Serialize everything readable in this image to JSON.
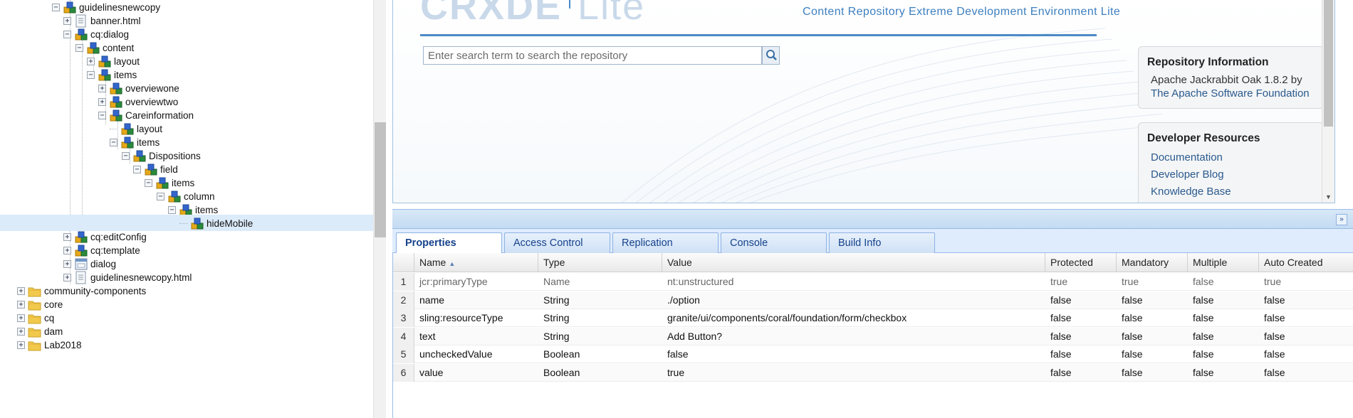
{
  "tree": {
    "nodes": [
      {
        "label": "guidelinesnewcopy",
        "toggle": "minus",
        "icon": "component-node-icon"
      },
      {
        "label": "banner.html",
        "toggle": "plus",
        "icon": "file-icon"
      },
      {
        "label": "cq:dialog",
        "toggle": "minus",
        "icon": "component-node-icon"
      },
      {
        "label": "content",
        "toggle": "minus",
        "icon": "component-node-icon"
      },
      {
        "label": "layout",
        "toggle": "plus",
        "icon": "component-node-icon"
      },
      {
        "label": "items",
        "toggle": "minus",
        "icon": "component-node-icon"
      },
      {
        "label": "overviewone",
        "toggle": "plus",
        "icon": "component-node-icon"
      },
      {
        "label": "overviewtwo",
        "toggle": "plus",
        "icon": "component-node-icon"
      },
      {
        "label": "Careinformation",
        "toggle": "minus",
        "icon": "component-node-icon"
      },
      {
        "label": "layout",
        "toggle": "none",
        "icon": "component-node-icon"
      },
      {
        "label": "items",
        "toggle": "minus",
        "icon": "component-node-icon"
      },
      {
        "label": "Dispositions",
        "toggle": "minus",
        "icon": "component-node-icon"
      },
      {
        "label": "field",
        "toggle": "minus",
        "icon": "component-node-icon"
      },
      {
        "label": "items",
        "toggle": "minus",
        "icon": "component-node-icon"
      },
      {
        "label": "column",
        "toggle": "minus",
        "icon": "component-node-icon"
      },
      {
        "label": "items",
        "toggle": "minus",
        "icon": "component-node-icon"
      },
      {
        "label": "hideMobile",
        "toggle": "none",
        "icon": "component-node-icon",
        "selected": true
      },
      {
        "label": "cq:editConfig",
        "toggle": "plus",
        "icon": "component-node-icon"
      },
      {
        "label": "cq:template",
        "toggle": "plus",
        "icon": "component-node-icon"
      },
      {
        "label": "dialog",
        "toggle": "plus",
        "icon": "dialog-icon"
      },
      {
        "label": "guidelinesnewcopy.html",
        "toggle": "plus",
        "icon": "file-icon"
      },
      {
        "label": "community-components",
        "toggle": "plus",
        "icon": "folder-icon"
      },
      {
        "label": "core",
        "toggle": "plus",
        "icon": "folder-icon"
      },
      {
        "label": "cq",
        "toggle": "plus",
        "icon": "folder-icon"
      },
      {
        "label": "dam",
        "toggle": "plus",
        "icon": "folder-icon"
      },
      {
        "label": "Lab2018",
        "toggle": "plus",
        "icon": "folder-icon"
      }
    ]
  },
  "header": {
    "logo_text_a": "CRXDE",
    "logo_text_b": "Lite",
    "tagline": "Content Repository Extreme Development Environment Lite"
  },
  "search": {
    "placeholder": "Enter search term to search the repository"
  },
  "repository_info": {
    "title": "Repository Information",
    "line1": "Apache Jackrabbit Oak 1.8.2 by",
    "link": "The Apache Software Foundation"
  },
  "developer_resources": {
    "title": "Developer Resources",
    "links": [
      "Documentation",
      "Developer Blog",
      "Knowledge Base"
    ]
  },
  "tabs": [
    {
      "label": "Properties",
      "active": true
    },
    {
      "label": "Access Control",
      "active": false
    },
    {
      "label": "Replication",
      "active": false
    },
    {
      "label": "Console",
      "active": false
    },
    {
      "label": "Build Info",
      "active": false
    }
  ],
  "grid": {
    "columns": [
      "Name",
      "Type",
      "Value",
      "Protected",
      "Mandatory",
      "Multiple",
      "Auto Created"
    ],
    "sorted_column": "Name",
    "sort_direction": "ascending",
    "rows": [
      {
        "num": "1",
        "name": "jcr:primaryType",
        "type": "Name",
        "value": "nt:unstructured",
        "protected": "true",
        "mandatory": "true",
        "multiple": "false",
        "auto": "true",
        "muted": true
      },
      {
        "num": "2",
        "name": "name",
        "type": "String",
        "value": "./option",
        "protected": "false",
        "mandatory": "false",
        "multiple": "false",
        "auto": "false"
      },
      {
        "num": "3",
        "name": "sling:resourceType",
        "type": "String",
        "value": "granite/ui/components/coral/foundation/form/checkbox",
        "protected": "false",
        "mandatory": "false",
        "multiple": "false",
        "auto": "false"
      },
      {
        "num": "4",
        "name": "text",
        "type": "String",
        "value": "Add Button?",
        "protected": "false",
        "mandatory": "false",
        "multiple": "false",
        "auto": "false"
      },
      {
        "num": "5",
        "name": "uncheckedValue",
        "type": "Boolean",
        "value": "false",
        "protected": "false",
        "mandatory": "false",
        "multiple": "false",
        "auto": "false"
      },
      {
        "num": "6",
        "name": "value",
        "type": "Boolean",
        "value": "true",
        "protected": "false",
        "mandatory": "false",
        "multiple": "false",
        "auto": "false"
      }
    ]
  },
  "colors": {
    "accent": "#4b8ac6",
    "link": "#2a5a8e",
    "selection": "#dcebfa",
    "tab_text": "#15428b"
  }
}
